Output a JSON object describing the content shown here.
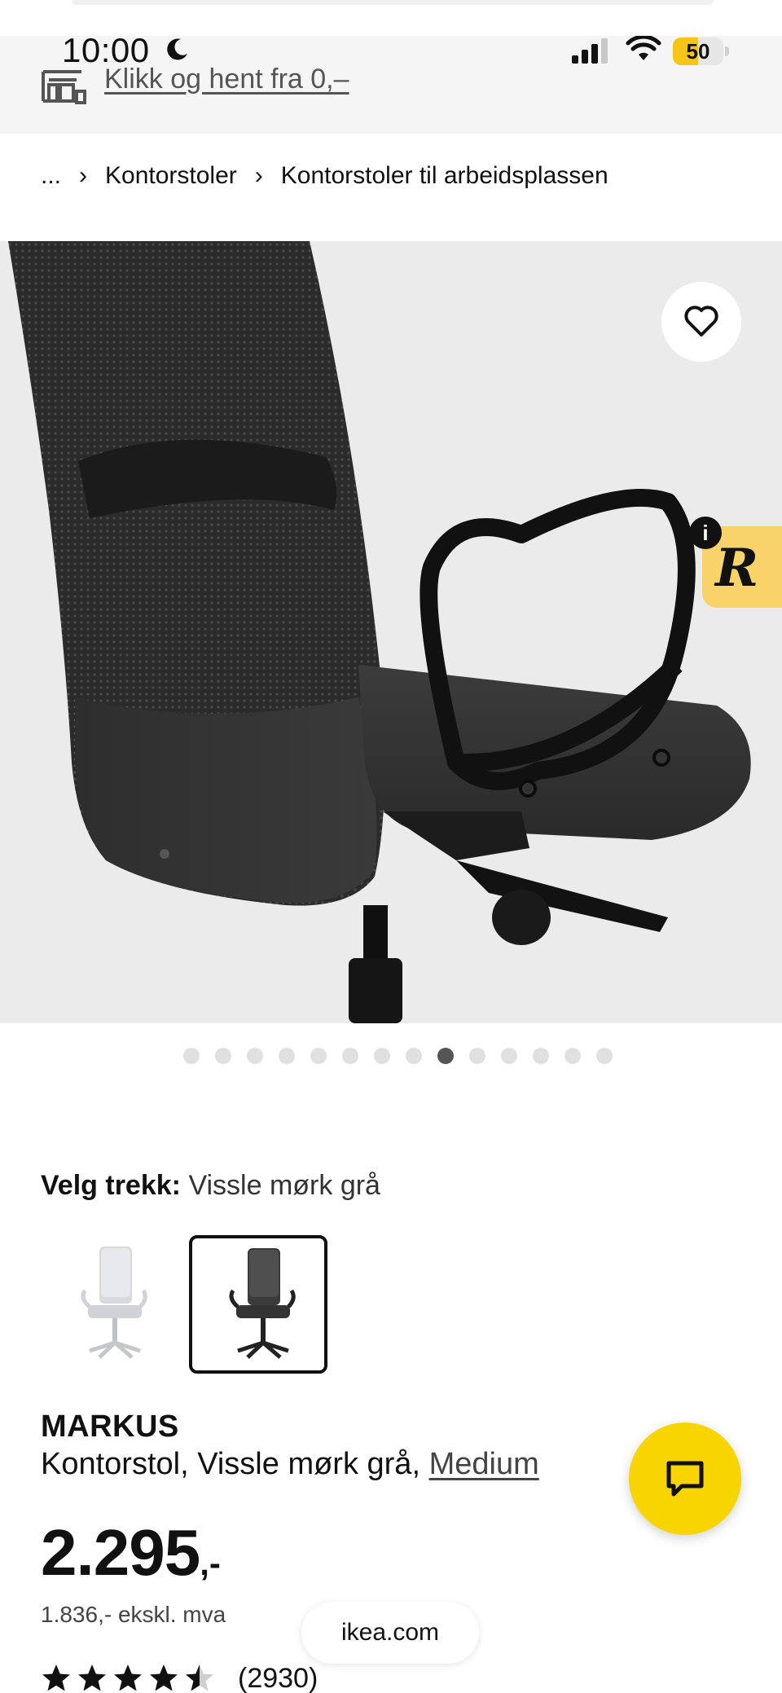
{
  "status_bar": {
    "time": "10:00",
    "moon_icon": "moon-icon",
    "signal_icon": "cellular-signal-icon",
    "wifi_icon": "wifi-icon",
    "battery_level": "50",
    "battery_fraction": 0.5
  },
  "banner": {
    "icon": "store-icon",
    "click_collect": "Klikk og hent fra 0,–"
  },
  "breadcrumb": {
    "ellipsis": "...",
    "separator": "›",
    "items": [
      "Kontorstoler",
      "Kontorstoler til arbeidsplassen"
    ]
  },
  "gallery": {
    "image_count": 14,
    "active_index": 8,
    "favorite_icon": "heart-icon",
    "badge_letter": "R",
    "badge_info": "i"
  },
  "variant": {
    "label": "Velg trekk:",
    "value": "Vissle mørk grå",
    "options": [
      "light-grey-chair",
      "dark-grey-chair"
    ],
    "selected_index": 1
  },
  "product": {
    "name": "MARKUS",
    "description": "Kontorstol, Vissle mørk grå,",
    "size_link": "Medium",
    "price_integer": "2.295",
    "price_suffix": ",-",
    "price_ex_vat": "1.836,- ekskl. mva",
    "rating_value": 4.5,
    "rating_count": "(2930)"
  },
  "chat_button": {
    "icon": "chat-icon"
  },
  "browser": {
    "domain": "ikea.com"
  },
  "colors": {
    "ikea_yellow": "#f8d400",
    "badge_yellow": "#f8d36a",
    "image_background": "#ebebeb",
    "active_dot": "#555555"
  }
}
